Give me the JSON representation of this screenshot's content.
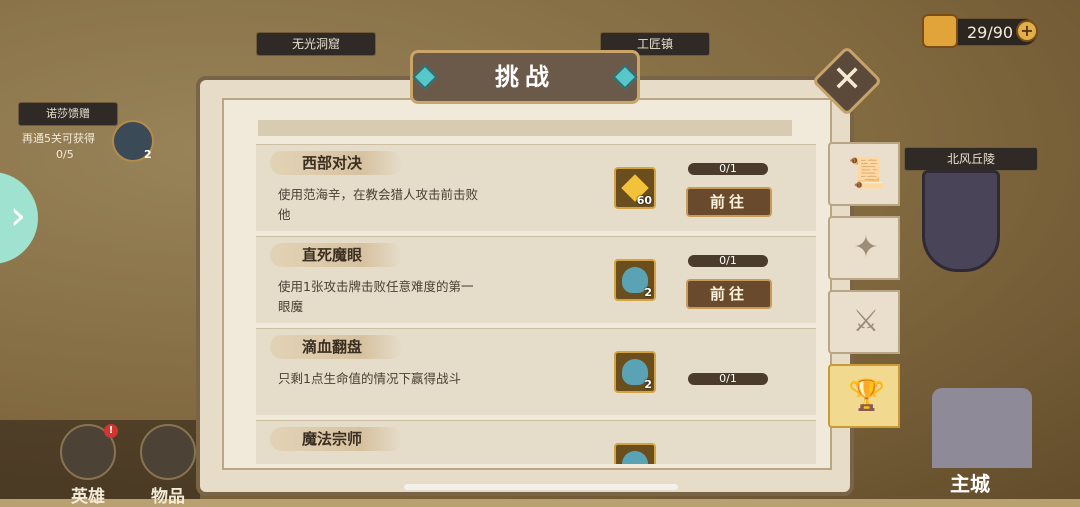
{
  "energy": {
    "value": "29/90",
    "plus": "+"
  },
  "map_labels": {
    "top_left_1": "无光洞窟",
    "top_left_2": "工匠镇",
    "boss": "北风丘陵"
  },
  "left_quest": {
    "name": "诺莎馈赠",
    "hint": "再通5关可获得",
    "progress": "0/5",
    "reward_count": "2"
  },
  "nav": {
    "heroes": "英雄",
    "items": "物品",
    "castle": "主城",
    "badge": "!"
  },
  "panel": {
    "title": "挑战",
    "close": "✕",
    "challenges": [
      {
        "title": "西部对决",
        "desc": "使用范海辛，在教会猎人攻击前击败他",
        "reward_icon": "gem-icon",
        "reward_count": "60",
        "progress": "0/1",
        "action": "前往"
      },
      {
        "title": "直死魔眼",
        "desc": "使用1张攻击牌击败任意难度的第一眼魔",
        "reward_icon": "potion-icon",
        "reward_count": "2",
        "progress": "0/1",
        "action": "前往"
      },
      {
        "title": "滴血翻盘",
        "desc": "只剩1点生命值的情况下赢得战斗",
        "reward_icon": "potion-icon",
        "reward_count": "2",
        "progress": "0/1",
        "action": ""
      },
      {
        "title": "魔法宗师",
        "desc": "",
        "reward_icon": "potion-icon",
        "reward_count": "",
        "progress": "",
        "action": ""
      }
    ]
  },
  "side_tabs": [
    {
      "icon": "scroll-icon",
      "glyph": "📜",
      "active": false
    },
    {
      "icon": "card-icon",
      "glyph": "✦",
      "active": false
    },
    {
      "icon": "swords-icon",
      "glyph": "⚔",
      "active": false
    },
    {
      "icon": "trophy-icon",
      "glyph": "🏆",
      "active": true
    }
  ],
  "colors": {
    "panel": "#f1e9d9",
    "active_tab": "#f1d990",
    "accent": "#c79b5c"
  }
}
